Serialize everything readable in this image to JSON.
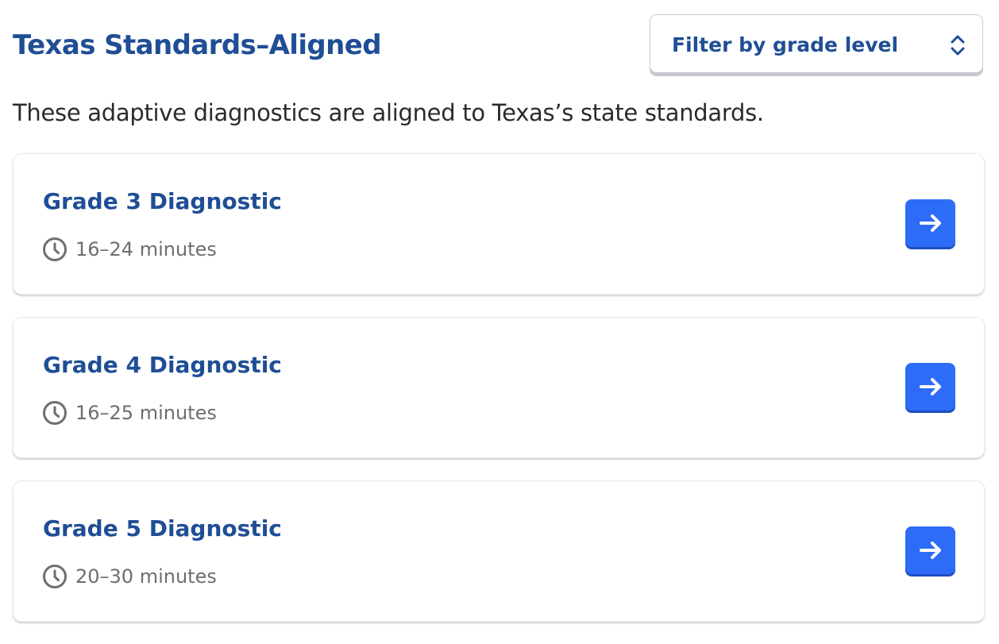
{
  "header": {
    "title": "Texas Standards–Aligned",
    "filter": {
      "label": "Filter by grade level",
      "icon": "chevron-updown-icon"
    }
  },
  "intro": "These adaptive diagnostics are aligned to Texas’s state standards.",
  "diagnostics": [
    {
      "title": "Grade 3 Diagnostic",
      "duration": "16–24 minutes",
      "icon": "clock-icon",
      "action_icon": "arrow-right-icon"
    },
    {
      "title": "Grade 4 Diagnostic",
      "duration": "16–25 minutes",
      "icon": "clock-icon",
      "action_icon": "arrow-right-icon"
    },
    {
      "title": "Grade 5 Diagnostic",
      "duration": "20–30 minutes",
      "icon": "clock-icon",
      "action_icon": "arrow-right-icon"
    }
  ],
  "colors": {
    "heading": "#1f4e95",
    "body_text": "#2b2b2b",
    "muted_text": "#6e6e6e",
    "accent_button": "#2d6cf6",
    "card_border": "#e7e9ec"
  }
}
